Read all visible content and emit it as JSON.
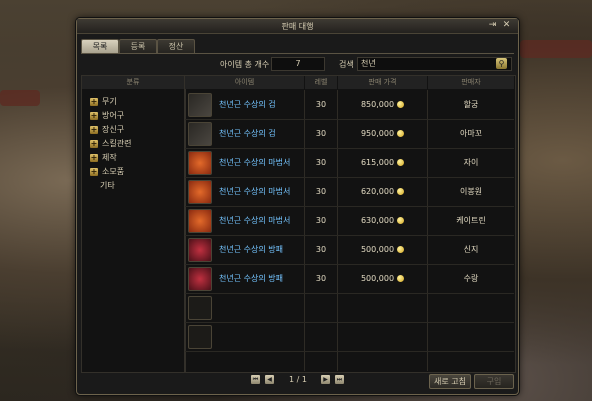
{
  "window": {
    "title": "판매 대행"
  },
  "tabs": [
    "목록",
    "등록",
    "정산"
  ],
  "search": {
    "count_label": "아이템 총 개수",
    "count_value": "7",
    "search_label": "검색",
    "search_value": "천년"
  },
  "category": {
    "header": "분류",
    "items": [
      {
        "label": "무기",
        "expandable": true
      },
      {
        "label": "방어구",
        "expandable": true
      },
      {
        "label": "장신구",
        "expandable": true
      },
      {
        "label": "스킬관련",
        "expandable": true
      },
      {
        "label": "제작",
        "expandable": true
      },
      {
        "label": "소모품",
        "expandable": true
      },
      {
        "label": "기타",
        "expandable": false
      }
    ]
  },
  "table": {
    "headers": [
      "아이템",
      "레벨",
      "판매 가격",
      "판매자"
    ],
    "rows": [
      {
        "icon": "sword-icon",
        "name": "천년근 수상의 검",
        "level": "30",
        "price": "850,000",
        "seller": "할궁"
      },
      {
        "icon": "sword-icon",
        "name": "천년근 수상의 검",
        "level": "30",
        "price": "950,000",
        "seller": "아마꼬"
      },
      {
        "icon": "spellbook-icon",
        "name": "천년근 수상의 마법서",
        "level": "30",
        "price": "615,000",
        "seller": "자이"
      },
      {
        "icon": "spellbook-icon",
        "name": "천년근 수상의 마법서",
        "level": "30",
        "price": "620,000",
        "seller": "이봉원"
      },
      {
        "icon": "spellbook-icon",
        "name": "천년근 수상의 마법서",
        "level": "30",
        "price": "630,000",
        "seller": "케이트린"
      },
      {
        "icon": "shield-icon",
        "name": "천년근 수상의 방패",
        "level": "30",
        "price": "500,000",
        "seller": "신지"
      },
      {
        "icon": "shield-icon",
        "name": "천년근 수상의 방패",
        "level": "30",
        "price": "500,000",
        "seller": "수랑"
      }
    ]
  },
  "pager": {
    "text": "1 / 1"
  },
  "buttons": {
    "refresh": "새로 고침",
    "buy": "구입"
  }
}
